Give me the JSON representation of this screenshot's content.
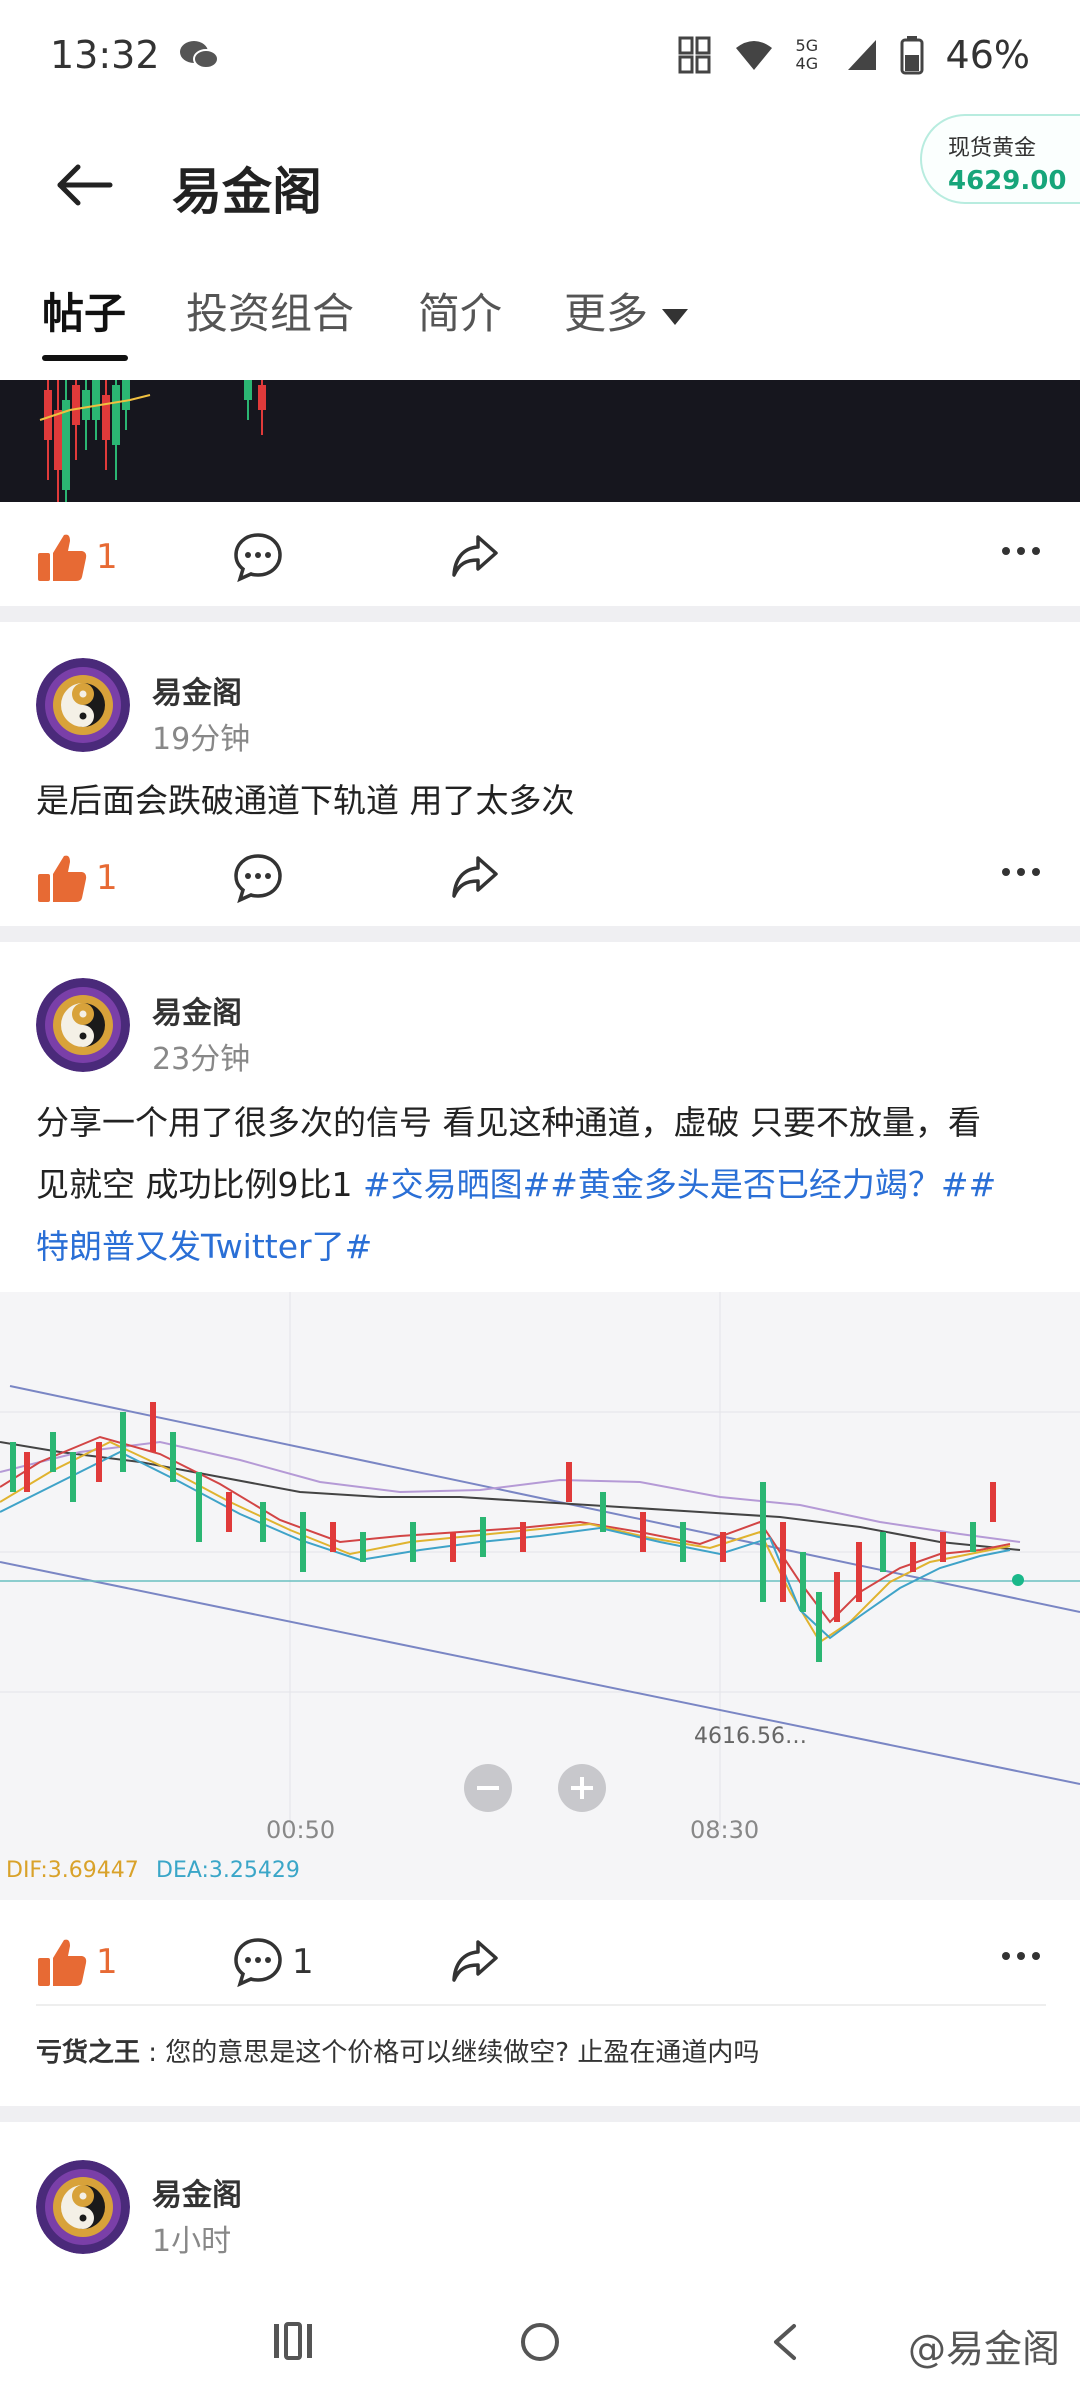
{
  "status": {
    "time": "13:32",
    "battery": "46%",
    "network": "5G 4G"
  },
  "header": {
    "title": "易金阁",
    "price_label": "现货黄金",
    "price_value": "4629.00"
  },
  "tabs": [
    {
      "label": "帖子",
      "active": true
    },
    {
      "label": "投资组合"
    },
    {
      "label": "简介"
    },
    {
      "label": "更多"
    }
  ],
  "post0": {
    "likes": "1"
  },
  "post1": {
    "author": "易金阁",
    "time": "19分钟",
    "text": "是后面会跌破通道下轨道 用了太多次",
    "likes": "1"
  },
  "post2": {
    "author": "易金阁",
    "time": "23分钟",
    "text_line1": "分享一个用了很多次的信号 看见这种通道，虚破 只要不放量，看",
    "text_line2_plain": "见就空 成功比例9比1 ",
    "text_line2_tag": "#交易晒图##黄金多头是否已经力竭？##",
    "text_line3_tag": "特朗普又发Twitter了#",
    "likes": "1",
    "comments": "1",
    "chart": {
      "time_labels": [
        "00:50",
        "08:30"
      ],
      "low_label": "4616.56…",
      "dif": "DIF:3.69447",
      "dea": "DEA:3.25429"
    },
    "comment": {
      "user": "亏货之王",
      "text": " : 您的意思是这个价格可以继续做空? 止盈在通道内吗"
    }
  },
  "post3": {
    "author": "易金阁",
    "time": "1小时"
  },
  "watermark": "@易金阁",
  "colors": {
    "like": "#e76a34",
    "tag": "#2a6fd6",
    "price": "#17a57a"
  }
}
